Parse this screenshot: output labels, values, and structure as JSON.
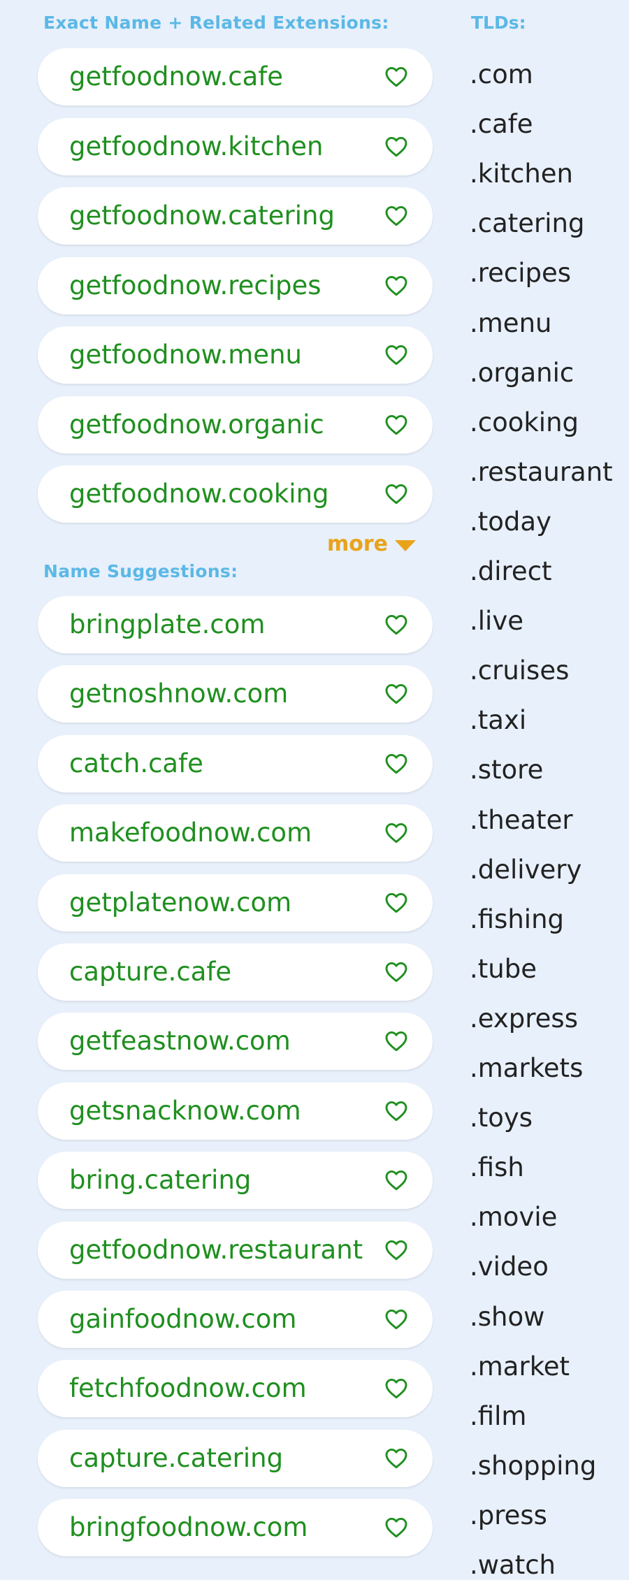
{
  "exact_section": {
    "title": "Exact Name + Related Extensions:",
    "items": [
      "getfoodnow.cafe",
      "getfoodnow.kitchen",
      "getfoodnow.catering",
      "getfoodnow.recipes",
      "getfoodnow.menu",
      "getfoodnow.organic",
      "getfoodnow.cooking"
    ],
    "more_label": "more"
  },
  "suggestions_section": {
    "title": "Name Suggestions:",
    "items": [
      "bringplate.com",
      "getnoshnow.com",
      "catch.cafe",
      "makefoodnow.com",
      "getplatenow.com",
      "capture.cafe",
      "getfeastnow.com",
      "getsnacknow.com",
      "bring.catering",
      "getfoodnow.restaurant",
      "gainfoodnow.com",
      "fetchfoodnow.com",
      "capture.catering",
      "bringfoodnow.com"
    ]
  },
  "tlds": {
    "title": "TLDs:",
    "items": [
      ".com",
      ".cafe",
      ".kitchen",
      ".catering",
      ".recipes",
      ".menu",
      ".organic",
      ".cooking",
      ".restaurant",
      ".today",
      ".direct",
      ".live",
      ".cruises",
      ".taxi",
      ".store",
      ".theater",
      ".delivery",
      ".fishing",
      ".tube",
      ".express",
      ".markets",
      ".toys",
      ".fish",
      ".movie",
      ".video",
      ".show",
      ".market",
      ".film",
      ".shopping",
      ".press",
      ".watch"
    ]
  },
  "colors": {
    "background": "#e8f0fb",
    "section_title": "#5bb8e6",
    "domain_text": "#1f8f1f",
    "more_accent": "#e9a31b",
    "tld_text": "#222222"
  },
  "icons": {
    "favorite": "heart-outline-icon",
    "expand": "triangle-down-icon"
  }
}
